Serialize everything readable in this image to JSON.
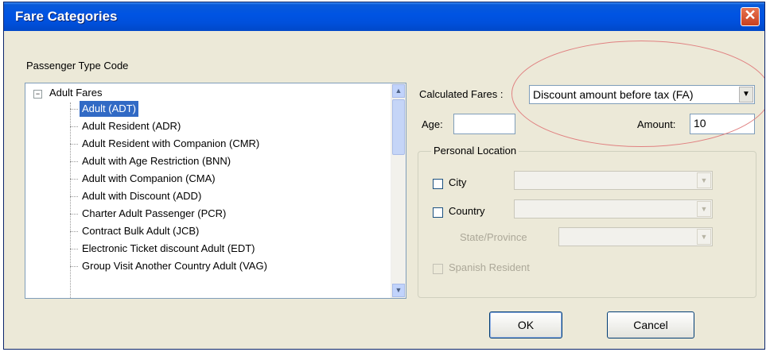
{
  "window": {
    "title": "Fare Categories"
  },
  "passenger_type": {
    "label": "Passenger Type Code",
    "root": "Adult Fares",
    "items": [
      "Adult (ADT)",
      "Adult Resident (ADR)",
      "Adult Resident with Companion (CMR)",
      "Adult with Age Restriction (BNN)",
      "Adult with Companion (CMA)",
      "Adult with Discount (ADD)",
      "Charter Adult Passenger (PCR)",
      "Contract Bulk Adult (JCB)",
      "Electronic Ticket discount Adult (EDT)",
      "Group Visit Another Country Adult (VAG)"
    ],
    "selected_index": 0
  },
  "calculated_fares": {
    "label": "Calculated Fares :",
    "value": "Discount amount before tax (FA)"
  },
  "age": {
    "label": "Age:",
    "value": ""
  },
  "amount": {
    "label": "Amount:",
    "value": "10"
  },
  "personal_location": {
    "title": "Personal Location",
    "city_label": "City",
    "country_label": "Country",
    "state_label": "State/Province",
    "spanish_resident_label": "Spanish Resident"
  },
  "buttons": {
    "ok": "OK",
    "cancel": "Cancel"
  },
  "colors": {
    "titlebar": "#0054e3",
    "selection": "#316ac5",
    "annotation": "#e08080"
  },
  "icons": {
    "close": "close-icon",
    "expander": "minus-icon",
    "dropdown": "chevron-down-icon"
  }
}
